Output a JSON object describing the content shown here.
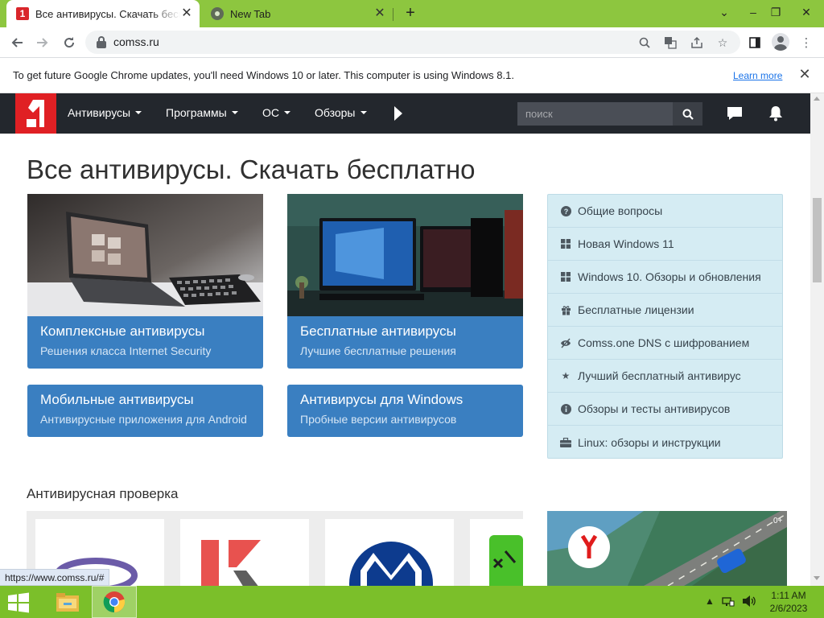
{
  "browser": {
    "tabs": [
      {
        "title": "Все антивирусы. Скачать бесплатно",
        "active": true,
        "favicon": "comss-favicon"
      },
      {
        "title": "New Tab",
        "active": false,
        "favicon": "chrome-favicon"
      }
    ],
    "new_tab": "+",
    "url": "comss.ru",
    "infobar": {
      "message": "To get future Google Chrome updates, you'll need Windows 10 or later. This computer is using Windows 8.1.",
      "link": "Learn more"
    },
    "status_url": "https://www.comss.ru/#",
    "accent": "#8dc63f"
  },
  "site": {
    "nav": {
      "items": [
        "Антивирусы",
        "Программы",
        "ОС",
        "Обзоры"
      ],
      "search_placeholder": "поиск"
    },
    "page_title": "Все антивирусы. Скачать бесплатно",
    "cards": [
      {
        "title": "Комплексные антивирусы",
        "subtitle": "Решения класса Internet Security"
      },
      {
        "title": "Бесплатные антивирусы",
        "subtitle": "Лучшие бесплатные решения"
      },
      {
        "title": "Мобильные антивирусы",
        "subtitle": "Антивирусные приложения для Android"
      },
      {
        "title": "Антивирусы для Windows",
        "subtitle": "Пробные версии антивирусов"
      }
    ],
    "sidebar": [
      {
        "label": "Общие вопросы",
        "icon": "question-circle-icon"
      },
      {
        "label": "Новая Windows 11",
        "icon": "windows-icon"
      },
      {
        "label": "Windows 10. Обзоры и обновления",
        "icon": "windows-icon"
      },
      {
        "label": "Бесплатные лицензии",
        "icon": "gift-icon"
      },
      {
        "label": "Comss.one DNS с шифрованием",
        "icon": "shield-icon"
      },
      {
        "label": "Лучший бесплатный антивирус",
        "icon": "star-icon"
      },
      {
        "label": "Обзоры и тесты антивирусов",
        "icon": "info-circle-icon"
      },
      {
        "label": "Linux: обзоры и инструкции",
        "icon": "briefcase-icon"
      }
    ],
    "section_title": "Антивирусная проверка",
    "ad_badge": "0+",
    "colors": {
      "nav_bg": "#23272d",
      "logo_red": "#e02024",
      "card_blue": "#3a7fc1",
      "sidebar_bg": "#d5ecf3"
    }
  },
  "taskbar": {
    "time": "1:11 AM",
    "date": "2/6/2023",
    "color": "#7bbf2a"
  }
}
